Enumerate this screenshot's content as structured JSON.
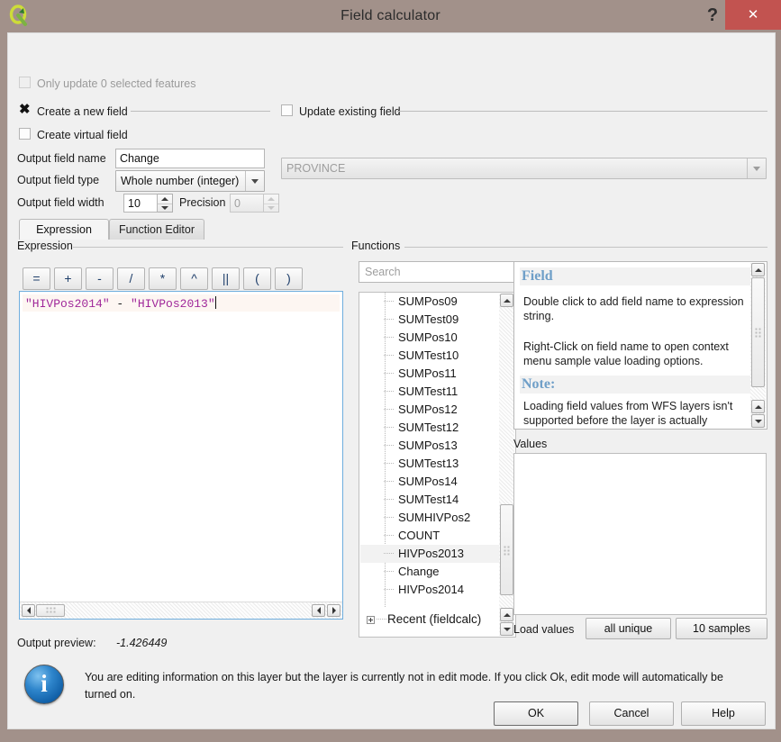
{
  "window": {
    "title": "Field calculator",
    "logo_icon": "qgis-logo-icon",
    "help_icon": "?",
    "close_icon": "✕"
  },
  "options": {
    "only_update_selected": {
      "label": "Only update 0 selected features",
      "checked": false,
      "enabled": false
    },
    "create_new_field": {
      "label": "Create a new field",
      "checked": true
    },
    "update_existing_field": {
      "label": "Update existing field",
      "checked": false
    },
    "create_virtual_field": {
      "label": "Create virtual field",
      "checked": false
    }
  },
  "form": {
    "field_name_label": "Output field name",
    "field_name_value": "Change",
    "field_type_label": "Output field type",
    "field_type_value": "Whole number (integer)",
    "field_width_label": "Output field width",
    "field_width_value": "10",
    "precision_label": "Precision",
    "precision_value": "0",
    "existing_field_value": "PROVINCE"
  },
  "tabs": [
    {
      "label": "Expression",
      "active": true
    },
    {
      "label": "Function Editor",
      "active": false
    }
  ],
  "expression": {
    "group_title": "Expression",
    "operators": [
      "=",
      "+",
      "-",
      "/",
      "*",
      "^",
      "||",
      "(",
      ")"
    ],
    "tokens": [
      {
        "text": "\"HIVPos2014\"",
        "kind": "string"
      },
      {
        "text": " - ",
        "kind": "operator"
      },
      {
        "text": "\"HIVPos2013\"",
        "kind": "string"
      }
    ],
    "text": "\"HIVPos2014\" - \"HIVPos2013\""
  },
  "output_preview": {
    "label": "Output preview:",
    "value": "-1.426449"
  },
  "functions": {
    "group_title": "Functions",
    "search_placeholder": "Search",
    "items": [
      {
        "label": "SUMPos09",
        "selected": false
      },
      {
        "label": "SUMTest09",
        "selected": false
      },
      {
        "label": "SUMPos10",
        "selected": false
      },
      {
        "label": "SUMTest10",
        "selected": false
      },
      {
        "label": "SUMPos11",
        "selected": false
      },
      {
        "label": "SUMTest11",
        "selected": false
      },
      {
        "label": "SUMPos12",
        "selected": false
      },
      {
        "label": "SUMTest12",
        "selected": false
      },
      {
        "label": "SUMPos13",
        "selected": false
      },
      {
        "label": "SUMTest13",
        "selected": false
      },
      {
        "label": "SUMPos14",
        "selected": false
      },
      {
        "label": "SUMTest14",
        "selected": false
      },
      {
        "label": "SUMHIVPos2",
        "selected": false
      },
      {
        "label": "COUNT",
        "selected": false
      },
      {
        "label": "HIVPos2013",
        "selected": true
      },
      {
        "label": "Change",
        "selected": false
      },
      {
        "label": "HIVPos2014",
        "selected": false
      }
    ],
    "recent_node": "Recent (fieldcalc)"
  },
  "help": {
    "heading": "Field",
    "paragraph1": "Double click to add field name to expression string.",
    "paragraph2": "Right-Click on field name to open context menu sample value loading options.",
    "note_heading": "Note:",
    "note_text": "Loading field values from WFS layers isn't supported  before the layer is actually"
  },
  "values": {
    "group_title": "Values",
    "load_values_label": "Load values",
    "all_unique_label": "all unique",
    "samples_label": "10 samples"
  },
  "message": {
    "icon": "info-icon",
    "text": "You are editing information on this layer but the layer is currently not in edit mode. If you click Ok, edit mode will automatically be turned on."
  },
  "buttons": {
    "ok": "OK",
    "cancel": "Cancel",
    "help": "Help"
  },
  "colors": {
    "titlebar": "#a2918a",
    "close": "#c25350",
    "panel": "#f0f0f0",
    "accent_string": "#a0289a",
    "help_heading": "#6f9fc8",
    "focus_border": "#6faede"
  }
}
